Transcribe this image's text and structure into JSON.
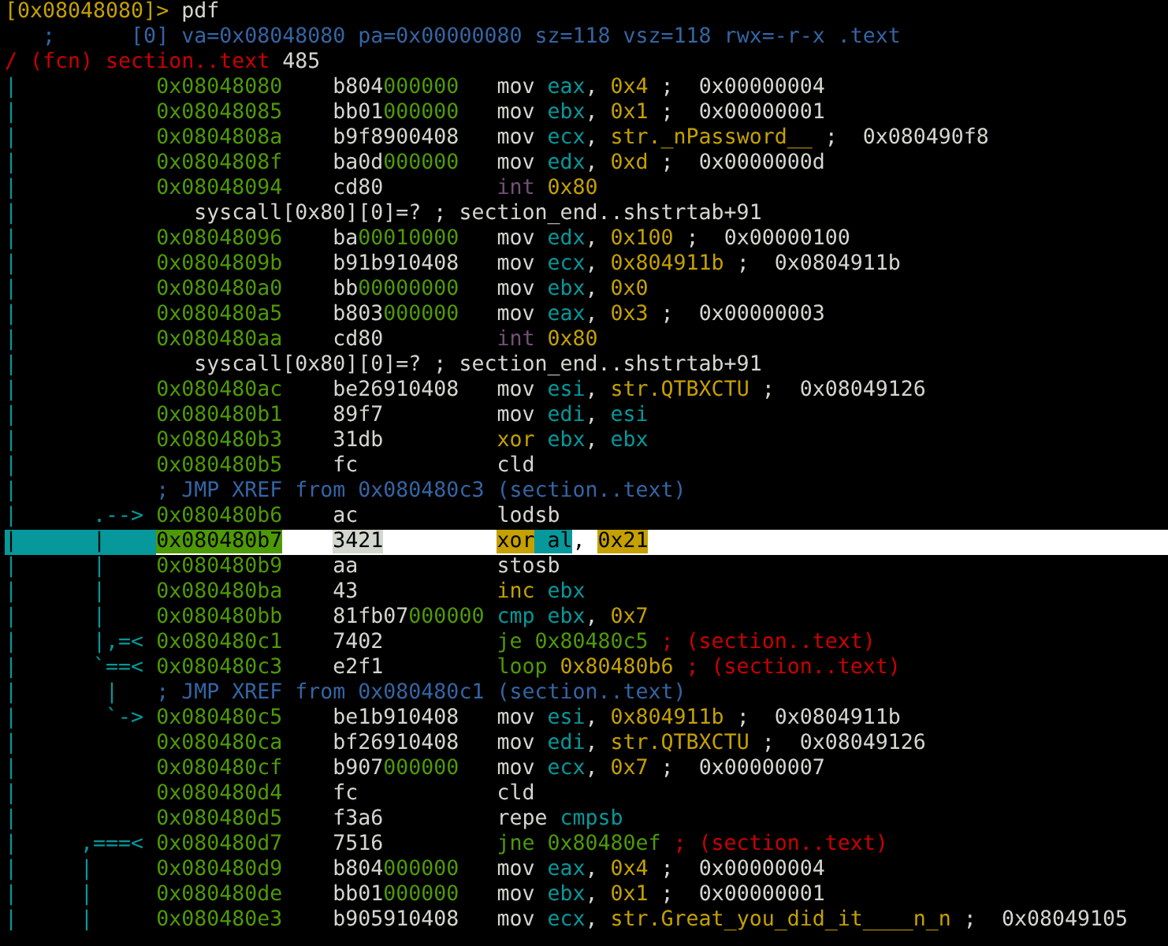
{
  "lines": [
    {
      "kind": "prompt",
      "selected": false,
      "segments": [
        {
          "text": "[0x08048080]>",
          "kind": "prompt"
        },
        {
          "text": " pdf",
          "kind": "plain"
        }
      ]
    },
    {
      "kind": "text",
      "selected": false,
      "segments": [
        {
          "text": "   ;      [0] va=0x08048080 pa=0x00000080 sz=118 vsz=118 rwx=-r-x .text",
          "kind": "info"
        }
      ]
    },
    {
      "kind": "text",
      "selected": false,
      "segments": [
        {
          "text": "/ (fcn) section..text",
          "kind": "ref"
        },
        {
          "text": " 485",
          "kind": "plain"
        }
      ]
    },
    {
      "kind": "insn",
      "selected": false,
      "gutter": "|",
      "addr": "0x08048080",
      "bytes": [
        {
          "text": "b804",
          "kind": "plain"
        },
        {
          "text": "000000",
          "kind": "zero"
        }
      ],
      "asm": [
        {
          "text": "mov ",
          "kind": "plain"
        },
        {
          "text": "eax",
          "kind": "reg"
        },
        {
          "text": ", ",
          "kind": "plain"
        },
        {
          "text": "0x4",
          "kind": "num"
        },
        {
          "text": " ;  0x00000004",
          "kind": "plain"
        }
      ]
    },
    {
      "kind": "insn",
      "selected": false,
      "gutter": "|",
      "addr": "0x08048085",
      "bytes": [
        {
          "text": "bb01",
          "kind": "plain"
        },
        {
          "text": "000000",
          "kind": "zero"
        }
      ],
      "asm": [
        {
          "text": "mov ",
          "kind": "plain"
        },
        {
          "text": "ebx",
          "kind": "reg"
        },
        {
          "text": ", ",
          "kind": "plain"
        },
        {
          "text": "0x1",
          "kind": "num"
        },
        {
          "text": " ;  0x00000001",
          "kind": "plain"
        }
      ]
    },
    {
      "kind": "insn",
      "selected": false,
      "gutter": "|",
      "addr": "0x0804808a",
      "bytes": [
        {
          "text": "b9f8900408",
          "kind": "plain"
        }
      ],
      "asm": [
        {
          "text": "mov ",
          "kind": "plain"
        },
        {
          "text": "ecx",
          "kind": "reg"
        },
        {
          "text": ", ",
          "kind": "plain"
        },
        {
          "text": "str._nPassword__",
          "kind": "num"
        },
        {
          "text": " ;  0x080490f8",
          "kind": "plain"
        }
      ]
    },
    {
      "kind": "insn",
      "selected": false,
      "gutter": "|",
      "addr": "0x0804808f",
      "bytes": [
        {
          "text": "ba0d",
          "kind": "plain"
        },
        {
          "text": "000000",
          "kind": "zero"
        }
      ],
      "asm": [
        {
          "text": "mov ",
          "kind": "plain"
        },
        {
          "text": "edx",
          "kind": "reg"
        },
        {
          "text": ", ",
          "kind": "plain"
        },
        {
          "text": "0xd",
          "kind": "num"
        },
        {
          "text": " ;  0x0000000d",
          "kind": "plain"
        }
      ]
    },
    {
      "kind": "insn",
      "selected": false,
      "gutter": "|",
      "addr": "0x08048094",
      "bytes": [
        {
          "text": "cd80",
          "kind": "plain"
        }
      ],
      "asm": [
        {
          "text": "int ",
          "kind": "sys"
        },
        {
          "text": "0x80",
          "kind": "num"
        }
      ]
    },
    {
      "kind": "syscall",
      "selected": false,
      "gutter": "|",
      "segments": [
        {
          "text": "syscall[0x80][0]=? ; section_end..shstrtab+91",
          "kind": "plain"
        }
      ]
    },
    {
      "kind": "insn",
      "selected": false,
      "gutter": "|",
      "addr": "0x08048096",
      "bytes": [
        {
          "text": "ba",
          "kind": "plain"
        },
        {
          "text": "00010000",
          "kind": "zero"
        }
      ],
      "asm": [
        {
          "text": "mov ",
          "kind": "plain"
        },
        {
          "text": "edx",
          "kind": "reg"
        },
        {
          "text": ", ",
          "kind": "plain"
        },
        {
          "text": "0x100",
          "kind": "num"
        },
        {
          "text": " ;  0x00000100",
          "kind": "plain"
        }
      ]
    },
    {
      "kind": "insn",
      "selected": false,
      "gutter": "|",
      "addr": "0x0804809b",
      "bytes": [
        {
          "text": "b91b910408",
          "kind": "plain"
        }
      ],
      "asm": [
        {
          "text": "mov ",
          "kind": "plain"
        },
        {
          "text": "ecx",
          "kind": "reg"
        },
        {
          "text": ", ",
          "kind": "plain"
        },
        {
          "text": "0x804911b",
          "kind": "num"
        },
        {
          "text": " ;  0x0804911b",
          "kind": "plain"
        }
      ]
    },
    {
      "kind": "insn",
      "selected": false,
      "gutter": "|",
      "addr": "0x080480a0",
      "bytes": [
        {
          "text": "bb",
          "kind": "plain"
        },
        {
          "text": "00000000",
          "kind": "zero"
        }
      ],
      "asm": [
        {
          "text": "mov ",
          "kind": "plain"
        },
        {
          "text": "ebx",
          "kind": "reg"
        },
        {
          "text": ", ",
          "kind": "plain"
        },
        {
          "text": "0x0",
          "kind": "num"
        }
      ]
    },
    {
      "kind": "insn",
      "selected": false,
      "gutter": "|",
      "addr": "0x080480a5",
      "bytes": [
        {
          "text": "b803",
          "kind": "plain"
        },
        {
          "text": "000000",
          "kind": "zero"
        }
      ],
      "asm": [
        {
          "text": "mov ",
          "kind": "plain"
        },
        {
          "text": "eax",
          "kind": "reg"
        },
        {
          "text": ", ",
          "kind": "plain"
        },
        {
          "text": "0x3",
          "kind": "num"
        },
        {
          "text": " ;  0x00000003",
          "kind": "plain"
        }
      ]
    },
    {
      "kind": "insn",
      "selected": false,
      "gutter": "|",
      "addr": "0x080480aa",
      "bytes": [
        {
          "text": "cd80",
          "kind": "plain"
        }
      ],
      "asm": [
        {
          "text": "int ",
          "kind": "sys"
        },
        {
          "text": "0x80",
          "kind": "num"
        }
      ]
    },
    {
      "kind": "syscall",
      "selected": false,
      "gutter": "|",
      "segments": [
        {
          "text": "syscall[0x80][0]=? ; section_end..shstrtab+91",
          "kind": "plain"
        }
      ]
    },
    {
      "kind": "insn",
      "selected": false,
      "gutter": "|",
      "addr": "0x080480ac",
      "bytes": [
        {
          "text": "be26910408",
          "kind": "plain"
        }
      ],
      "asm": [
        {
          "text": "mov ",
          "kind": "plain"
        },
        {
          "text": "esi",
          "kind": "reg"
        },
        {
          "text": ", ",
          "kind": "plain"
        },
        {
          "text": "str.QTBXCTU",
          "kind": "num"
        },
        {
          "text": " ;  0x08049126",
          "kind": "plain"
        }
      ]
    },
    {
      "kind": "insn",
      "selected": false,
      "gutter": "|",
      "addr": "0x080480b1",
      "bytes": [
        {
          "text": "89f7",
          "kind": "plain"
        }
      ],
      "asm": [
        {
          "text": "mov ",
          "kind": "plain"
        },
        {
          "text": "edi",
          "kind": "reg"
        },
        {
          "text": ", ",
          "kind": "plain"
        },
        {
          "text": "esi",
          "kind": "reg"
        }
      ]
    },
    {
      "kind": "insn",
      "selected": false,
      "gutter": "|",
      "addr": "0x080480b3",
      "bytes": [
        {
          "text": "31db",
          "kind": "plain"
        }
      ],
      "asm": [
        {
          "text": "xor ",
          "kind": "num"
        },
        {
          "text": "ebx",
          "kind": "reg"
        },
        {
          "text": ", ",
          "kind": "plain"
        },
        {
          "text": "ebx",
          "kind": "reg"
        }
      ]
    },
    {
      "kind": "insn",
      "selected": false,
      "gutter": "|",
      "addr": "0x080480b5",
      "bytes": [
        {
          "text": "fc",
          "kind": "plain"
        }
      ],
      "asm": [
        {
          "text": "cld",
          "kind": "plain"
        }
      ]
    },
    {
      "kind": "xref",
      "selected": false,
      "gutter": "|",
      "segments": [
        {
          "text": "; JMP XREF from 0x080480c3 (section..text)",
          "kind": "info"
        }
      ]
    },
    {
      "kind": "insn",
      "selected": false,
      "gutter": "|      .-->",
      "addr": "0x080480b6",
      "bytes": [
        {
          "text": "ac",
          "kind": "plain"
        }
      ],
      "asm": [
        {
          "text": "lodsb",
          "kind": "plain"
        }
      ]
    },
    {
      "kind": "insn",
      "selected": true,
      "gutter": "|      |",
      "addr": "0x080480b7",
      "bytes": [
        {
          "text": "3421",
          "kind": "plain"
        }
      ],
      "asm": [
        {
          "text": "xor",
          "kind": "num"
        },
        {
          "text": " al",
          "kind": "reg"
        },
        {
          "text": ", ",
          "kind": "plain"
        },
        {
          "text": "0x21",
          "kind": "num"
        }
      ]
    },
    {
      "kind": "insn",
      "selected": false,
      "gutter": "|      |",
      "addr": "0x080480b9",
      "bytes": [
        {
          "text": "aa",
          "kind": "plain"
        }
      ],
      "asm": [
        {
          "text": "stosb",
          "kind": "plain"
        }
      ]
    },
    {
      "kind": "insn",
      "selected": false,
      "gutter": "|      |",
      "addr": "0x080480ba",
      "bytes": [
        {
          "text": "43",
          "kind": "plain"
        }
      ],
      "asm": [
        {
          "text": "inc ",
          "kind": "num"
        },
        {
          "text": "ebx",
          "kind": "reg"
        }
      ]
    },
    {
      "kind": "insn",
      "selected": false,
      "gutter": "|      |",
      "addr": "0x080480bb",
      "bytes": [
        {
          "text": "81fb07",
          "kind": "plain"
        },
        {
          "text": "000000",
          "kind": "zero"
        }
      ],
      "asm": [
        {
          "text": "cmp ",
          "kind": "reg"
        },
        {
          "text": "ebx",
          "kind": "reg"
        },
        {
          "text": ", ",
          "kind": "plain"
        },
        {
          "text": "0x7",
          "kind": "num"
        }
      ]
    },
    {
      "kind": "insn",
      "selected": false,
      "gutter": "|      |,=<",
      "addr": "0x080480c1",
      "bytes": [
        {
          "text": "7402",
          "kind": "plain"
        }
      ],
      "asm": [
        {
          "text": "je 0x80480c5",
          "kind": "jump"
        },
        {
          "text": " ; (section..text)",
          "kind": "ref"
        }
      ]
    },
    {
      "kind": "insn",
      "selected": false,
      "gutter": "|      `==<",
      "addr": "0x080480c3",
      "bytes": [
        {
          "text": "e2f1",
          "kind": "plain"
        }
      ],
      "asm": [
        {
          "text": "loop ",
          "kind": "jump"
        },
        {
          "text": "0x80480b6",
          "kind": "num"
        },
        {
          "text": " ; (section..text)",
          "kind": "ref"
        }
      ]
    },
    {
      "kind": "xref",
      "selected": false,
      "gutter": "|       |",
      "segments": [
        {
          "text": "; JMP XREF from 0x080480c1 (section..text)",
          "kind": "info"
        }
      ]
    },
    {
      "kind": "insn",
      "selected": false,
      "gutter": "|       `->",
      "addr": "0x080480c5",
      "bytes": [
        {
          "text": "be1b910408",
          "kind": "plain"
        }
      ],
      "asm": [
        {
          "text": "mov ",
          "kind": "plain"
        },
        {
          "text": "esi",
          "kind": "reg"
        },
        {
          "text": ", ",
          "kind": "plain"
        },
        {
          "text": "0x804911b",
          "kind": "num"
        },
        {
          "text": " ;  0x0804911b",
          "kind": "plain"
        }
      ]
    },
    {
      "kind": "insn",
      "selected": false,
      "gutter": "|",
      "addr": "0x080480ca",
      "bytes": [
        {
          "text": "bf26910408",
          "kind": "plain"
        }
      ],
      "asm": [
        {
          "text": "mov ",
          "kind": "plain"
        },
        {
          "text": "edi",
          "kind": "reg"
        },
        {
          "text": ", ",
          "kind": "plain"
        },
        {
          "text": "str.QTBXCTU",
          "kind": "num"
        },
        {
          "text": " ;  0x08049126",
          "kind": "plain"
        }
      ]
    },
    {
      "kind": "insn",
      "selected": false,
      "gutter": "|",
      "addr": "0x080480cf",
      "bytes": [
        {
          "text": "b907",
          "kind": "plain"
        },
        {
          "text": "000000",
          "kind": "zero"
        }
      ],
      "asm": [
        {
          "text": "mov ",
          "kind": "plain"
        },
        {
          "text": "ecx",
          "kind": "reg"
        },
        {
          "text": ", ",
          "kind": "plain"
        },
        {
          "text": "0x7",
          "kind": "num"
        },
        {
          "text": " ;  0x00000007",
          "kind": "plain"
        }
      ]
    },
    {
      "kind": "insn",
      "selected": false,
      "gutter": "|",
      "addr": "0x080480d4",
      "bytes": [
        {
          "text": "fc",
          "kind": "plain"
        }
      ],
      "asm": [
        {
          "text": "cld",
          "kind": "plain"
        }
      ]
    },
    {
      "kind": "insn",
      "selected": false,
      "gutter": "|",
      "addr": "0x080480d5",
      "bytes": [
        {
          "text": "f3a6",
          "kind": "plain"
        }
      ],
      "asm": [
        {
          "text": "repe ",
          "kind": "plain"
        },
        {
          "text": "cmpsb",
          "kind": "reg"
        }
      ]
    },
    {
      "kind": "insn",
      "selected": false,
      "gutter": "|     ,===<",
      "addr": "0x080480d7",
      "bytes": [
        {
          "text": "7516",
          "kind": "plain"
        }
      ],
      "asm": [
        {
          "text": "jne 0x80480ef",
          "kind": "jump"
        },
        {
          "text": " ; (section..text)",
          "kind": "ref"
        }
      ]
    },
    {
      "kind": "insn",
      "selected": false,
      "gutter": "|     |",
      "addr": "0x080480d9",
      "bytes": [
        {
          "text": "b804",
          "kind": "plain"
        },
        {
          "text": "000000",
          "kind": "zero"
        }
      ],
      "asm": [
        {
          "text": "mov ",
          "kind": "plain"
        },
        {
          "text": "eax",
          "kind": "reg"
        },
        {
          "text": ", ",
          "kind": "plain"
        },
        {
          "text": "0x4",
          "kind": "num"
        },
        {
          "text": " ;  0x00000004",
          "kind": "plain"
        }
      ]
    },
    {
      "kind": "insn",
      "selected": false,
      "gutter": "|     |",
      "addr": "0x080480de",
      "bytes": [
        {
          "text": "bb01",
          "kind": "plain"
        },
        {
          "text": "000000",
          "kind": "zero"
        }
      ],
      "asm": [
        {
          "text": "mov ",
          "kind": "plain"
        },
        {
          "text": "ebx",
          "kind": "reg"
        },
        {
          "text": ", ",
          "kind": "plain"
        },
        {
          "text": "0x1",
          "kind": "num"
        },
        {
          "text": " ;  0x00000001",
          "kind": "plain"
        }
      ]
    },
    {
      "kind": "insn",
      "selected": false,
      "gutter": "|     |",
      "addr": "0x080480e3",
      "bytes": [
        {
          "text": "b905910408",
          "kind": "plain"
        }
      ],
      "asm": [
        {
          "text": "mov ",
          "kind": "plain"
        },
        {
          "text": "ecx",
          "kind": "reg"
        },
        {
          "text": ", ",
          "kind": "plain"
        },
        {
          "text": "str.Great_you_did_it____n_n",
          "kind": "num"
        },
        {
          "text": " ;  0x08049105",
          "kind": "plain"
        }
      ]
    }
  ]
}
